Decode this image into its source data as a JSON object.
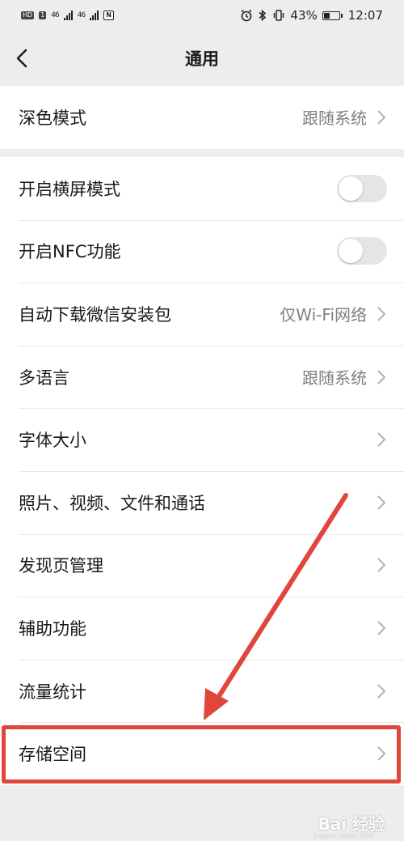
{
  "status_bar": {
    "chip1": "HD",
    "chip2": "1",
    "sig1": "46",
    "sig2": "46",
    "nfc": "N",
    "battery_text": "43%",
    "battery_level": 0.43,
    "time": "12:07"
  },
  "nav": {
    "title": "通用"
  },
  "group1": {
    "rows": [
      {
        "label": "深色模式",
        "value": "跟随系统"
      }
    ]
  },
  "group2": {
    "rows": [
      {
        "label": "开启横屏模式",
        "toggle": false
      },
      {
        "label": "开启NFC功能",
        "toggle": false
      },
      {
        "label": "自动下载微信安装包",
        "value": "仅Wi-Fi网络"
      },
      {
        "label": "多语言",
        "value": "跟随系统"
      },
      {
        "label": "字体大小"
      },
      {
        "label": "照片、视频、文件和通话"
      },
      {
        "label": "发现页管理"
      },
      {
        "label": "辅助功能"
      },
      {
        "label": "流量统计"
      },
      {
        "label": "存储空间"
      }
    ]
  },
  "annotation": {
    "color": "#e0463c"
  },
  "watermark": {
    "text": "Bai 经验",
    "sub": "jingyan.baidu.com"
  },
  "icons": [
    "back-icon",
    "chevron-right-icon",
    "alarm-icon",
    "bluetooth-icon",
    "vibrate-icon",
    "battery-icon"
  ]
}
